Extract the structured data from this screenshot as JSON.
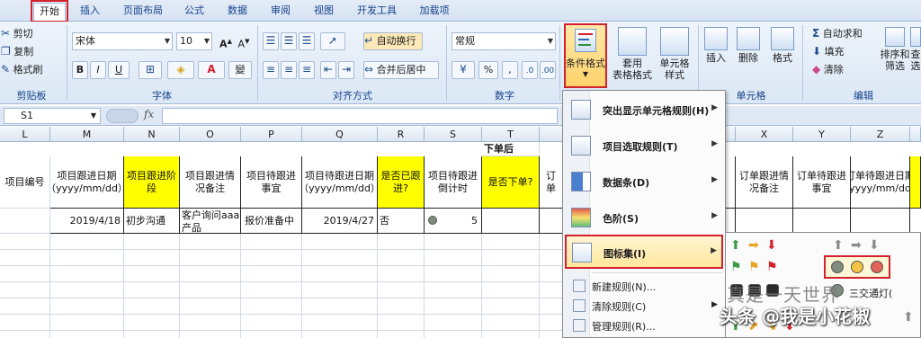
{
  "ribbon_tabs": [
    "开始",
    "插入",
    "页面布局",
    "公式",
    "数据",
    "审阅",
    "视图",
    "开发工具",
    "加载项"
  ],
  "clipboard": {
    "cut": "剪切",
    "copy": "复制",
    "format_painter": "格式刷",
    "group": "剪贴板"
  },
  "font": {
    "name": "宋体",
    "size": "10",
    "bold": "B",
    "italic": "I",
    "underline": "U",
    "group": "字体",
    "change_case": "變"
  },
  "alignment": {
    "wrap_text": "自动换行",
    "merge_center": "合并后居中",
    "group": "对齐方式"
  },
  "number": {
    "format": "常规",
    "group": "数字",
    "percent": "%",
    "comma": ","
  },
  "styles": {
    "conditional_format_line1": "条件格式",
    "table_format_line1": "套用",
    "table_format_line2": "表格格式",
    "cell_style_line1": "单元格",
    "cell_style_line2": "样式"
  },
  "cells": {
    "insert": "插入",
    "delete": "删除",
    "format": "格式",
    "group": "单元格"
  },
  "editing": {
    "autosum": "自动求和",
    "fill": "填充",
    "clear": "清除",
    "sort_line1": "排序和",
    "sort_line2": "筛选",
    "find_line1": "查",
    "find_line2": "选",
    "group": "编辑"
  },
  "formula_bar": {
    "name_box": "S1",
    "fx": "fx",
    "value": ""
  },
  "columns": [
    "L",
    "M",
    "N",
    "O",
    "P",
    "Q",
    "R",
    "S",
    "T",
    "X",
    "Y",
    "Z"
  ],
  "headers": {
    "L": "项目编号",
    "M": "项目跟进日期（yyyy/mm/dd）",
    "N": "项目跟进阶段",
    "O": "项目跟进情况备注",
    "P": "项目待跟进事宜",
    "Q": "项目待跟进日期（yyyy/mm/dd）",
    "R": "是否已跟进?",
    "S": "项目待跟进倒计时",
    "T_top": "下单后",
    "T": "是否下单?",
    "U_partial": "订单",
    "W_partial": "",
    "X": "订单跟进情况备注",
    "Y": "订单待跟进事宜",
    "Z": "订单待跟进日期（yyyy/mm/dd）"
  },
  "row1": {
    "M": "2019/4/18",
    "N": "初步沟通",
    "O": "客户询问aaa产品",
    "P": "报价准备中",
    "Q": "2019/4/27",
    "R": "否",
    "S": "5"
  },
  "cf_menu": {
    "highlight_rules": "突出显示单元格规则(H)",
    "top_bottom": "项目选取规则(T)",
    "data_bars": "数据条(D)",
    "color_scales": "色阶(S)",
    "icon_sets": "图标集(I)",
    "new_rule": "新建规则(N)...",
    "clear_rules": "清除规则(C)",
    "manage_rules": "管理规则(R)..."
  },
  "submenu": {
    "traffic_partial": "三交通灯("
  },
  "colors": {
    "accent_red": "#d3212d",
    "highlight_yellow": "#ffff00",
    "dot_gray": "#7f8c80",
    "dot_yellow": "#f6c445",
    "dot_red": "#e0645a"
  },
  "watermark": {
    "line1": "真是一天世界",
    "line2": "头条 @我是小花椒"
  }
}
